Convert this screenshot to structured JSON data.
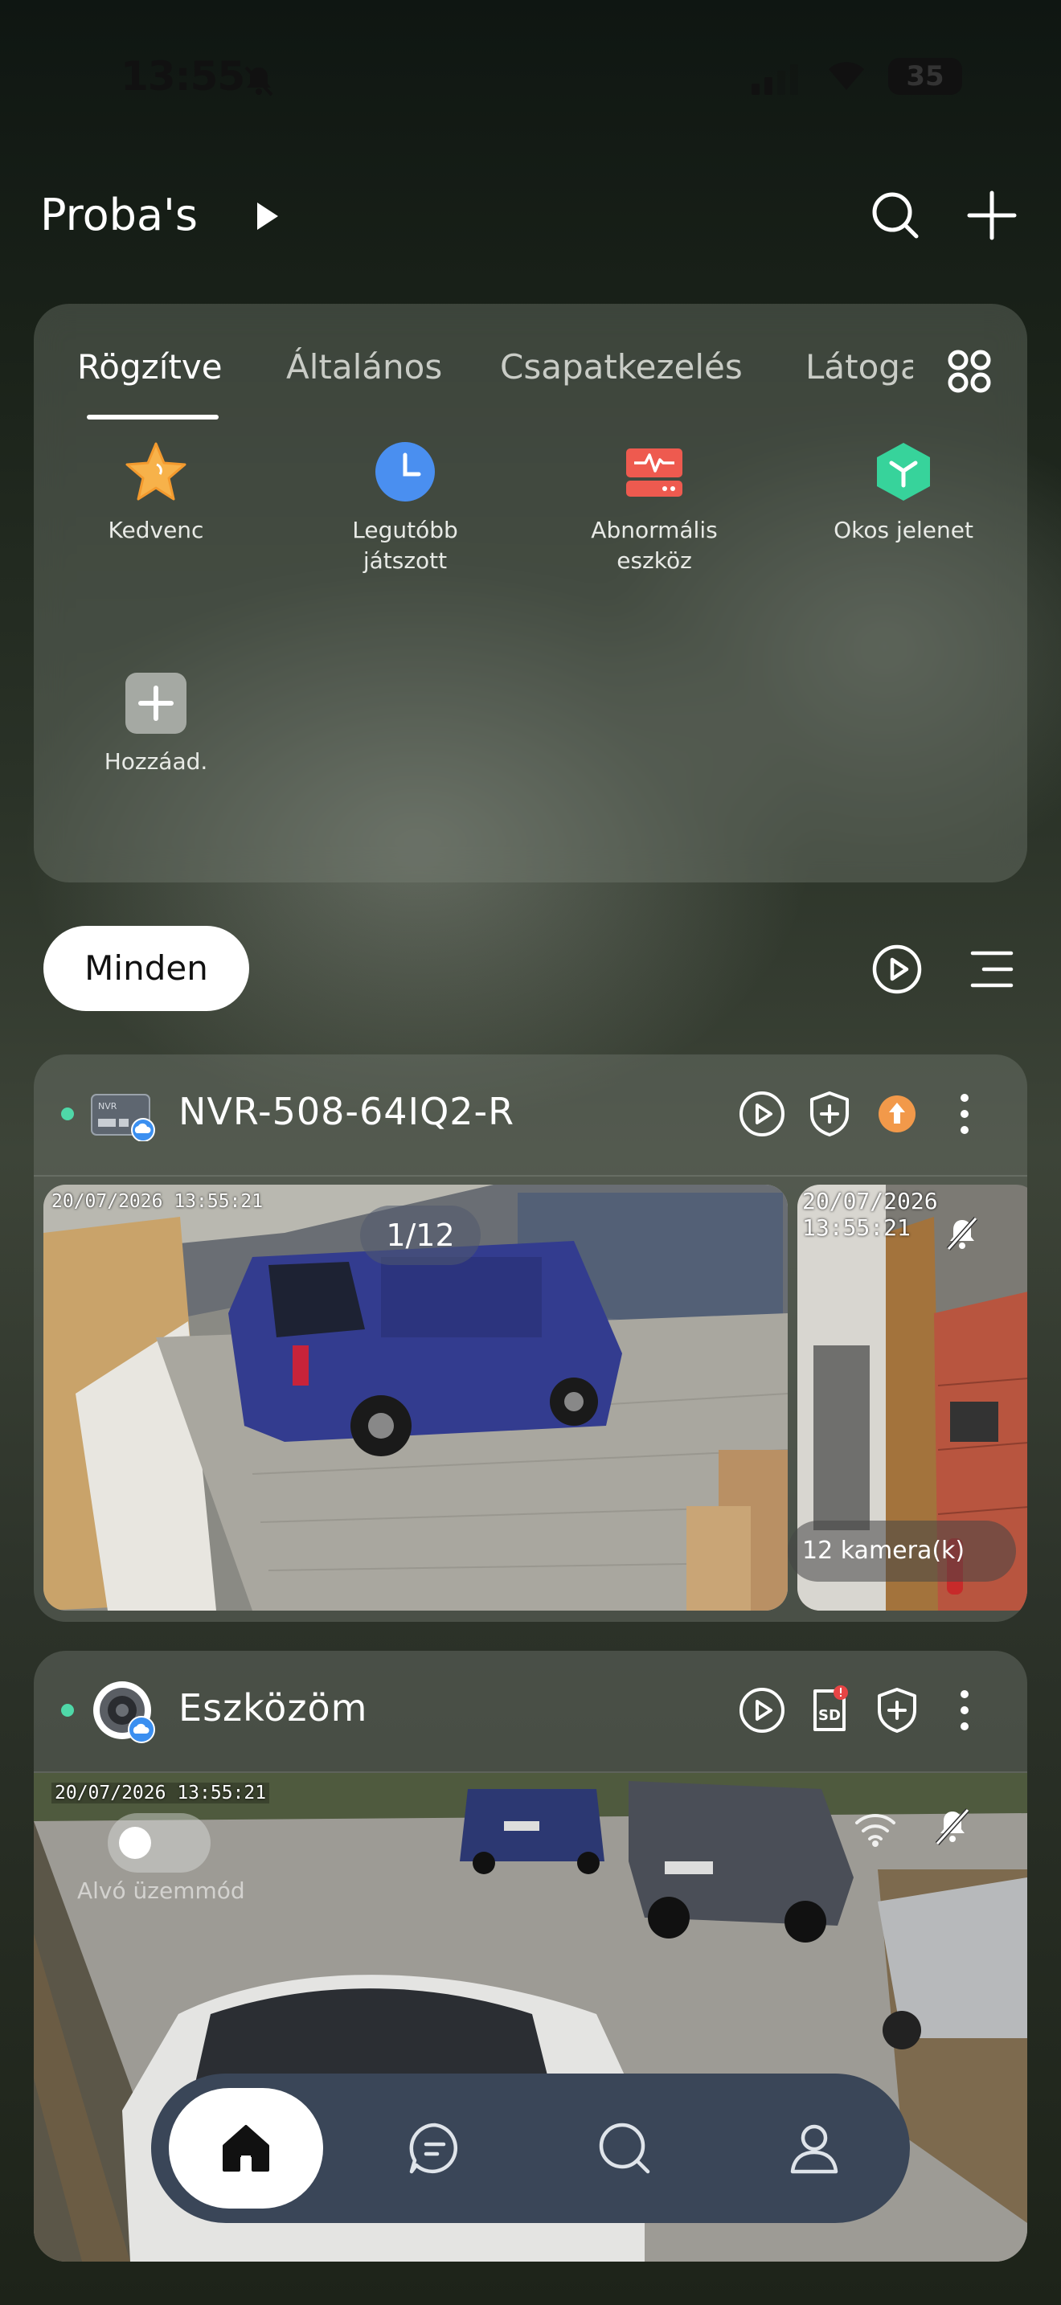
{
  "status_bar": {
    "time": "13:55",
    "battery": "35"
  },
  "header": {
    "title": "Proba's"
  },
  "tabs": [
    {
      "label": "Rögzítve",
      "active": true
    },
    {
      "label": "Általános",
      "active": false
    },
    {
      "label": "Csapatkezelés",
      "active": false
    },
    {
      "label": "Látoga",
      "active": false
    }
  ],
  "shortcuts": [
    {
      "label_lines": [
        "Kedvenc"
      ],
      "icon": "star-icon"
    },
    {
      "label_lines": [
        "Legutóbb",
        "játszott"
      ],
      "icon": "clock-icon"
    },
    {
      "label_lines": [
        "Abnormális",
        "eszköz"
      ],
      "icon": "abnormal-device-icon"
    },
    {
      "label_lines": [
        "Okos jelenet"
      ],
      "icon": "smart-scene-icon"
    },
    {
      "label_lines": [
        "Hozzáad."
      ],
      "icon": "add-icon"
    }
  ],
  "filter": {
    "label": "Minden"
  },
  "devices": [
    {
      "name": "NVR-508-64IQ2-R",
      "online": true,
      "page_indicator": "1/12",
      "camera_count": "12 kamera(k)",
      "timestamp_main": "20/07/2026 13:55:21",
      "timestamp_side": "20/07/2026 13:55:21"
    },
    {
      "name": "Eszközöm",
      "online": true,
      "timestamp": "20/07/2026 13:55:21",
      "sleep_mode_label": "Alvó üzemmód",
      "sd_badge": "SD"
    }
  ],
  "colors": {
    "online_dot": "#4fd8a8",
    "upgrade_orange": "#f2994a",
    "nav_bg": "#3a4658",
    "cloud_blue": "#3b8ff0"
  }
}
